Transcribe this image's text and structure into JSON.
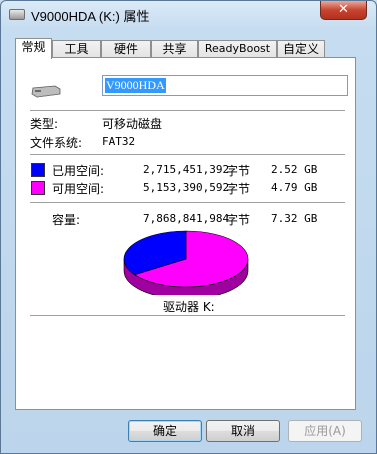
{
  "window": {
    "title": "V9000HDA (K:) 属性",
    "close_glyph": "✕"
  },
  "tabs": [
    {
      "label": "常规",
      "active": true
    },
    {
      "label": "工具"
    },
    {
      "label": "硬件"
    },
    {
      "label": "共享"
    },
    {
      "label": "ReadyBoost"
    },
    {
      "label": "自定义"
    }
  ],
  "general": {
    "volume_name": "V9000HDA",
    "type_label": "类型:",
    "type_value": "可移动磁盘",
    "fs_label": "文件系统:",
    "fs_value": "FAT32",
    "used_label": "已用空间:",
    "used_bytes": "2,715,451,392",
    "used_unit": "字节",
    "used_human": "2.52 GB",
    "free_label": "可用空间:",
    "free_bytes": "5,153,390,592",
    "free_unit": "字节",
    "free_human": "4.79 GB",
    "capacity_label": "容量:",
    "capacity_bytes": "7,868,841,984",
    "capacity_unit": "字节",
    "capacity_human": "7.32 GB",
    "drive_label": "驱动器 K:"
  },
  "colors": {
    "used": "#0000ff",
    "free": "#ff00ff"
  },
  "pie": {
    "used_fraction": 0.345,
    "free_fraction": 0.655
  },
  "buttons": {
    "ok": "确定",
    "cancel": "取消",
    "apply": "应用(A)"
  }
}
